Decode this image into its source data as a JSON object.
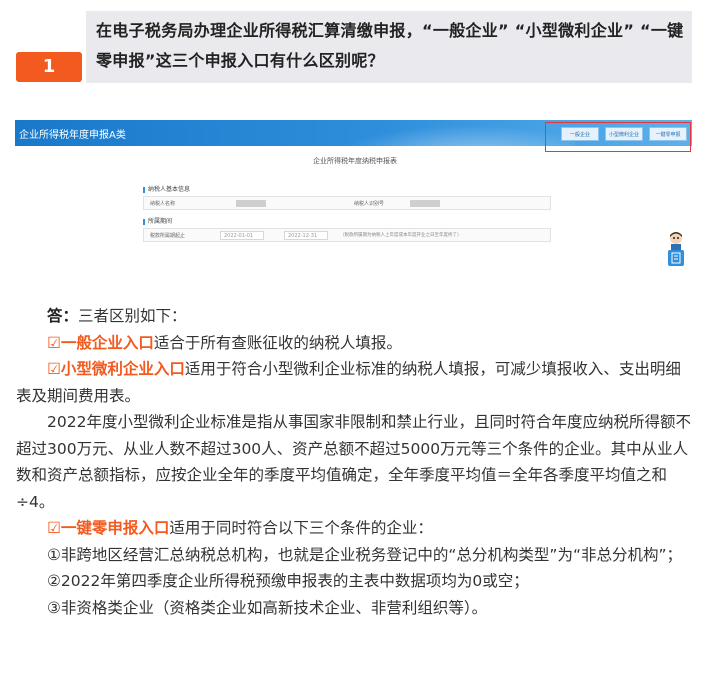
{
  "question": {
    "number": "1",
    "text": "在电子税务局办理企业所得税汇算清缴申报，“一般企业” “小型微利企业” “一键零申报”这三个申报入口有什么区别呢？"
  },
  "screenshot": {
    "banner_title": "企业所得税年度申报A类",
    "buttons": [
      "一般企业",
      "小型微利企业",
      "一键零申报"
    ],
    "form_title": "企业所得税年度纳税申报表",
    "section1": "纳税人基本信息",
    "taxpayer_name_label": "纳税人名称",
    "taxpayer_id_label": "纳税人识别号",
    "section2": "所属期间",
    "period_label": "税款所属期起止",
    "period_start": "2022-01-01",
    "period_end": "2022-12-31",
    "period_note": "（税款所属期为纳税人上年度或本年度开业之日至年度终了）",
    "colors": {
      "banner": "#1a78c9",
      "highlight_box": "#e03a3a"
    }
  },
  "answer": {
    "label": "答：",
    "intro": "三者区别如下：",
    "check": "☑",
    "general": {
      "name": "一般企业入口",
      "desc": "适合于所有查账征收的纳税人填报。"
    },
    "small": {
      "name": "小型微利企业入口",
      "desc": "适用于符合小型微利企业标准的纳税人填报，可减少填报收入、支出明细表及期间费用表。"
    },
    "small_standard": "2022年度小型微利企业标准是指从事国家非限制和禁止行业，且同时符合年度应纳税所得额不超过300万元、从业人数不超过300人、资产总额不超过5000万元等三个条件的企业。其中从业人数和资产总额指标，应按企业全年的季度平均值确定，全年季度平均值＝全年各季度平均值之和÷4。",
    "zero": {
      "name": "一键零申报入口",
      "desc": "适用于同时符合以下三个条件的企业："
    },
    "conditions": [
      "①非跨地区经营汇总纳税总机构，也就是企业税务登记中的“总分机构类型”为“非总分机构”；",
      "②2022年第四季度企业所得税预缴申报表的主表中数据项均为0或空；",
      "③非资格类企业（资格类企业如高新技术企业、非营利组织等）。"
    ],
    "accent_color": "#f25a1f"
  }
}
